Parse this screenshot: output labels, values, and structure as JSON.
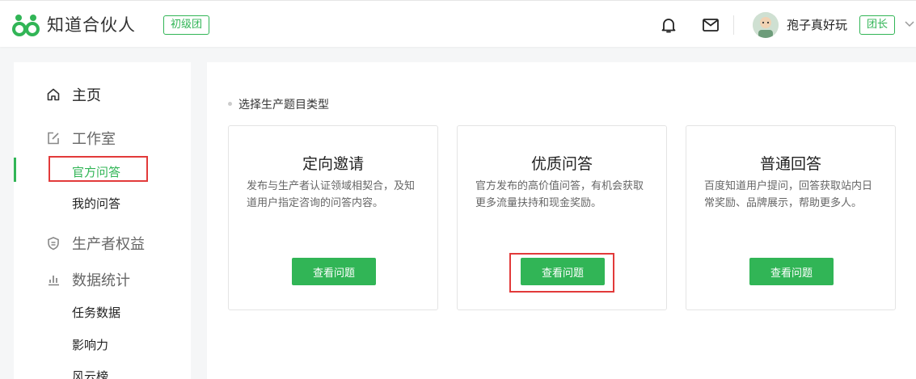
{
  "header": {
    "brand": "知道合伙人",
    "level_badge": "初级团",
    "username": "孢子真好玩",
    "role_badge": "团长"
  },
  "sidebar": {
    "items": [
      {
        "label": "主页",
        "icon": "home-icon"
      },
      {
        "label": "工作室",
        "icon": "edit-icon",
        "children": [
          "官方问答",
          "我的问答"
        ]
      },
      {
        "label": "生产者权益",
        "icon": "shield-icon"
      },
      {
        "label": "数据统计",
        "icon": "bar-chart-icon",
        "children": [
          "任务数据",
          "影响力",
          "风云榜"
        ]
      }
    ]
  },
  "main": {
    "section_title": "选择生产题目类型",
    "cards": [
      {
        "title": "定向邀请",
        "desc": "发布与生产者认证领域相契合，及知道用户指定咨询的问答内容。",
        "button": "查看问题"
      },
      {
        "title": "优质问答",
        "desc": "官方发布的高价值问答，有机会获取更多流量扶持和现金奖励。",
        "button": "查看问题"
      },
      {
        "title": "普通回答",
        "desc": "百度知道用户提问，回答获取站内日常奖励、品牌展示，帮助更多人。",
        "button": "查看问题"
      }
    ]
  },
  "colors": {
    "accent": "#31b556",
    "highlight": "#e23a3a",
    "background": "#f5f6f7"
  }
}
